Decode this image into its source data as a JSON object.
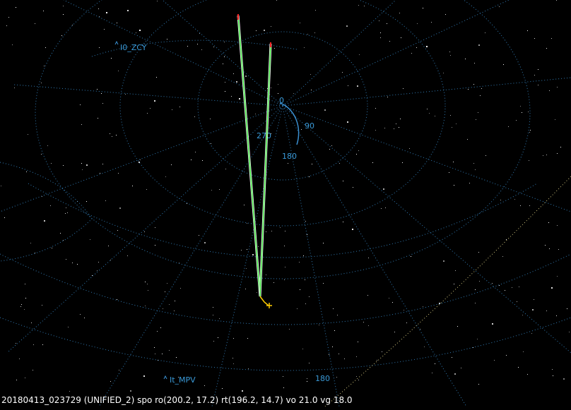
{
  "stations": [
    {
      "label": "I0_ZCY"
    },
    {
      "label": "It_MPV"
    }
  ],
  "compass": {
    "north": "0",
    "east": "90",
    "south": "180",
    "west": "270"
  },
  "azimuth_label": "180",
  "status_line": "20180413_023729 (UNIFIED_2) spo ro(200.2, 17.2) rt(196.2, 14.7) vo 21.0 vg 18.0",
  "colors": {
    "grid": "#3a8fd0",
    "label": "#3a9ad8",
    "track_outer": "#ffffff",
    "track_inner": "#22dd22",
    "track_end": "#ff2222",
    "meteor": "#ffcc00",
    "stars": "#ffffff"
  }
}
